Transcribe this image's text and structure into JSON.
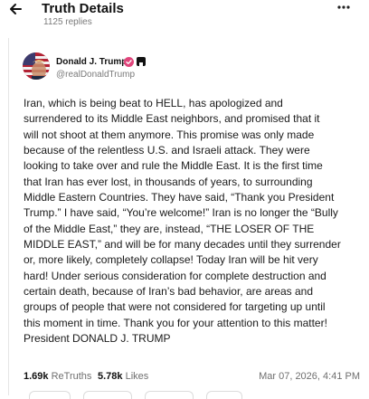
{
  "header": {
    "title": "Truth Details",
    "replies": "1125 replies",
    "back_icon": "arrow-left-icon",
    "more_icon": "more-horizontal-icon"
  },
  "author": {
    "name": "Donald J. Trump",
    "handle": "@realDonaldTrump",
    "verified_color": "#e0457b"
  },
  "post": {
    "text": "Iran, which is being beat to HELL, has apologized and\nsurrendered to its Middle East neighbors, and promised that it\nwill not shoot at them anymore. This promise was only made\nbecause of the relentless U.S. and Israeli attack. They were\nlooking to take over and rule the Middle East. It is the first time\nthat Iran has ever lost, in thousands of years, to surrounding\nMiddle Eastern Countries. They have said, “Thank you President\nTrump.” I have said, “You’re welcome!” Iran is no longer the “Bully\nof the Middle East,” they are, instead, “THE LOSER OF THE\nMIDDLE EAST,” and will be for many decades until they surrender\nor, more likely, completely collapse! Today Iran will be hit very\nhard! Under serious consideration for complete destruction and\ncertain death, because of Iran’s bad behavior, are areas and\ngroups of people that were not considered for targeting up until\nthis moment in time. Thank you for your attention to this matter!\nPresident DONALD J. TRUMP"
  },
  "stats": {
    "retruths_count": "1.69k",
    "retruths_label": "ReTruths",
    "likes_count": "5.78k",
    "likes_label": "Likes",
    "timestamp": "Mar 07, 2026, 4:41 PM"
  }
}
